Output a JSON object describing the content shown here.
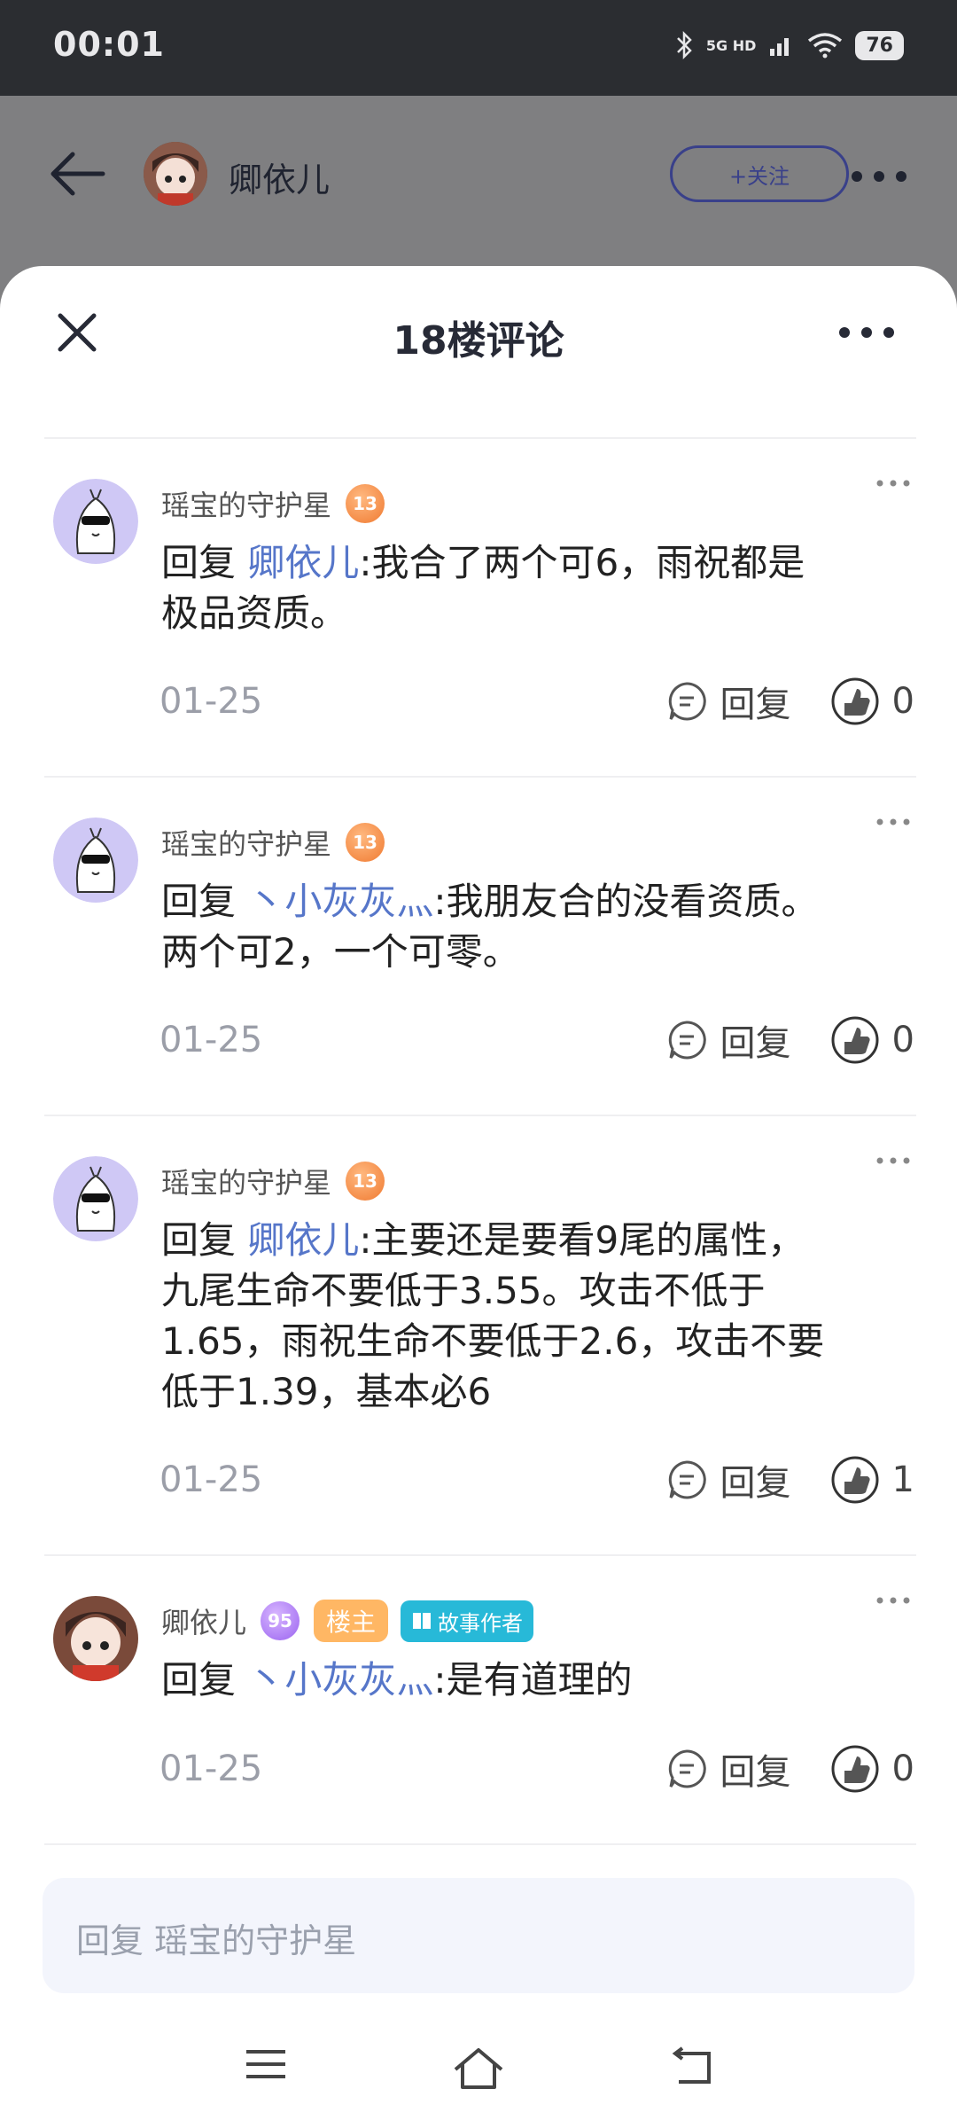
{
  "status_bar": {
    "time": "00:01",
    "network": "5G HD",
    "battery": "76"
  },
  "app_header": {
    "author": "卿依儿",
    "follow_label": "+关注"
  },
  "sheet": {
    "title": "18楼评论"
  },
  "comments": [
    {
      "user": "瑶宝的守护星",
      "level": "13",
      "reply_prefix": "回复",
      "reply_to": "卿依儿",
      "separator": ":",
      "lines": [
        "我合了两个可6，雨祝都是",
        "极品资质。"
      ],
      "date": "01-25",
      "reply_label": "回复",
      "likes": "0"
    },
    {
      "user": "瑶宝的守护星",
      "level": "13",
      "reply_prefix": "回复",
      "reply_to": "丶小灰灰灬",
      "separator": ":",
      "lines": [
        "我朋友合的没看资质。",
        "两个可2，一个可零。"
      ],
      "date": "01-25",
      "reply_label": "回复",
      "likes": "0"
    },
    {
      "user": "瑶宝的守护星",
      "level": "13",
      "reply_prefix": "回复",
      "reply_to": "卿依儿",
      "separator": ":",
      "lines": [
        "主要还是要看9尾的属性，",
        "九尾生命不要低于3.55。攻击不低于",
        "1.65，雨祝生命不要低于2.6，攻击不要",
        "低于1.39，基本必6"
      ],
      "date": "01-25",
      "reply_label": "回复",
      "likes": "1"
    },
    {
      "user": "卿依儿",
      "level": "95",
      "owner_tag": "楼主",
      "story_tag": "故事作者",
      "reply_prefix": "回复",
      "reply_to": "丶小灰灰灬",
      "separator": ":",
      "lines": [
        "是有道理的"
      ],
      "date": "01-25",
      "reply_label": "回复",
      "likes": "0"
    }
  ],
  "input": {
    "placeholder": "回复 瑶宝的守护星"
  }
}
